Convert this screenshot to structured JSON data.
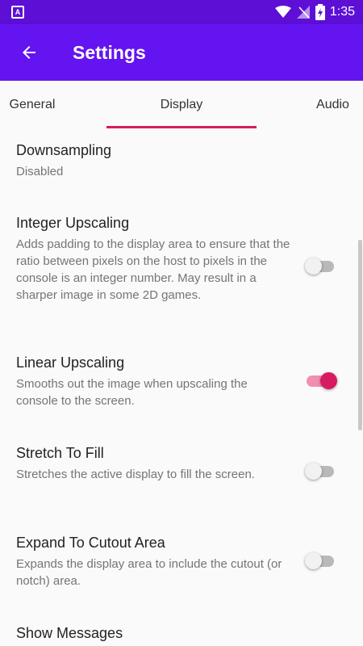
{
  "status_bar": {
    "time": "1:35",
    "icons": [
      "android-notification-icon",
      "wifi-icon",
      "signal-icon",
      "battery-charging-icon"
    ]
  },
  "app_bar": {
    "title": "Settings",
    "back_icon": "arrow-back-icon"
  },
  "tabs": [
    {
      "label": "General",
      "selected": false
    },
    {
      "label": "Display",
      "selected": true
    },
    {
      "label": "Audio",
      "selected": false
    }
  ],
  "colors": {
    "status_bar": "#5d0fd6",
    "app_bar": "#6414f0",
    "accent": "#d81b60"
  },
  "preferences": [
    {
      "title": "Downsampling",
      "summary": "Disabled"
    },
    {
      "title": "Integer Upscaling",
      "summary": "Adds padding to the display area to ensure that the ratio between pixels on the host to pixels in the console is an integer number. May result in a sharper image in some 2D games.",
      "enabled": false
    },
    {
      "title": "Linear Upscaling",
      "summary": "Smooths out the image when upscaling the console to the screen.",
      "enabled": true
    },
    {
      "title": "Stretch To Fill",
      "summary": "Stretches the active display to fill the screen.",
      "enabled": false
    },
    {
      "title": "Expand To Cutout Area",
      "summary": "Expands the display area to include the cutout (or notch) area.",
      "enabled": false
    },
    {
      "title": "Show Messages"
    }
  ]
}
